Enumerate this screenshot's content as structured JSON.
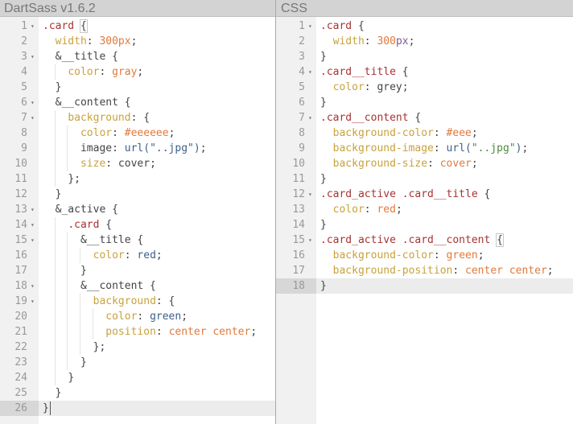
{
  "left_pane": {
    "title": "DartSass v1.6.2",
    "active_line": 26,
    "lines": [
      {
        "n": "1",
        "fold": true,
        "indent": 0,
        "tokens": [
          {
            "t": "sel",
            "v": ".card"
          },
          {
            "t": "plain",
            "v": " "
          },
          {
            "t": "plain",
            "v": "{",
            "match": true
          }
        ]
      },
      {
        "n": "2",
        "fold": false,
        "indent": 1,
        "tokens": [
          {
            "t": "prop",
            "v": "width"
          },
          {
            "t": "plain",
            "v": ": "
          },
          {
            "t": "num",
            "v": "300px"
          },
          {
            "t": "plain",
            "v": ";"
          }
        ]
      },
      {
        "n": "3",
        "fold": true,
        "indent": 1,
        "tokens": [
          {
            "t": "plain",
            "v": "&__title {"
          }
        ]
      },
      {
        "n": "4",
        "fold": false,
        "indent": 2,
        "tokens": [
          {
            "t": "prop",
            "v": "color"
          },
          {
            "t": "plain",
            "v": ": "
          },
          {
            "t": "val",
            "v": "gray"
          },
          {
            "t": "plain",
            "v": ";"
          }
        ]
      },
      {
        "n": "5",
        "fold": false,
        "indent": 1,
        "tokens": [
          {
            "t": "plain",
            "v": "}"
          }
        ]
      },
      {
        "n": "6",
        "fold": true,
        "indent": 1,
        "tokens": [
          {
            "t": "plain",
            "v": "&__content {"
          }
        ]
      },
      {
        "n": "7",
        "fold": true,
        "indent": 2,
        "tokens": [
          {
            "t": "prop",
            "v": "background"
          },
          {
            "t": "plain",
            "v": ": {"
          }
        ]
      },
      {
        "n": "8",
        "fold": false,
        "indent": 3,
        "tokens": [
          {
            "t": "prop",
            "v": "color"
          },
          {
            "t": "plain",
            "v": ": "
          },
          {
            "t": "hex",
            "v": "#eeeeee"
          },
          {
            "t": "plain",
            "v": ";"
          }
        ]
      },
      {
        "n": "9",
        "fold": false,
        "indent": 3,
        "tokens": [
          {
            "t": "plain",
            "v": "image: "
          },
          {
            "t": "url",
            "v": "url(\"..jpg\")"
          },
          {
            "t": "plain",
            "v": ";"
          }
        ]
      },
      {
        "n": "10",
        "fold": false,
        "indent": 3,
        "tokens": [
          {
            "t": "prop",
            "v": "size"
          },
          {
            "t": "plain",
            "v": ": cover;"
          }
        ]
      },
      {
        "n": "11",
        "fold": false,
        "indent": 2,
        "tokens": [
          {
            "t": "plain",
            "v": "};"
          }
        ]
      },
      {
        "n": "12",
        "fold": false,
        "indent": 1,
        "tokens": [
          {
            "t": "plain",
            "v": "}"
          }
        ]
      },
      {
        "n": "13",
        "fold": true,
        "indent": 1,
        "tokens": [
          {
            "t": "plain",
            "v": "&_active {"
          }
        ]
      },
      {
        "n": "14",
        "fold": true,
        "indent": 2,
        "tokens": [
          {
            "t": "sel",
            "v": ".card"
          },
          {
            "t": "plain",
            "v": " {"
          }
        ]
      },
      {
        "n": "15",
        "fold": true,
        "indent": 3,
        "tokens": [
          {
            "t": "plain",
            "v": "&__title {"
          }
        ]
      },
      {
        "n": "16",
        "fold": false,
        "indent": 4,
        "tokens": [
          {
            "t": "prop",
            "v": "color"
          },
          {
            "t": "plain",
            "v": ": "
          },
          {
            "t": "kw",
            "v": "red"
          },
          {
            "t": "plain",
            "v": ";"
          }
        ]
      },
      {
        "n": "17",
        "fold": false,
        "indent": 3,
        "tokens": [
          {
            "t": "plain",
            "v": "}"
          }
        ]
      },
      {
        "n": "18",
        "fold": true,
        "indent": 3,
        "tokens": [
          {
            "t": "plain",
            "v": "&__content {"
          }
        ]
      },
      {
        "n": "19",
        "fold": true,
        "indent": 4,
        "tokens": [
          {
            "t": "prop",
            "v": "background"
          },
          {
            "t": "plain",
            "v": ": {"
          }
        ]
      },
      {
        "n": "20",
        "fold": false,
        "indent": 5,
        "tokens": [
          {
            "t": "prop",
            "v": "color"
          },
          {
            "t": "plain",
            "v": ": "
          },
          {
            "t": "kw",
            "v": "green"
          },
          {
            "t": "plain",
            "v": ";"
          }
        ]
      },
      {
        "n": "21",
        "fold": false,
        "indent": 5,
        "tokens": [
          {
            "t": "prop",
            "v": "position"
          },
          {
            "t": "plain",
            "v": ": "
          },
          {
            "t": "val",
            "v": "center center"
          },
          {
            "t": "plain",
            "v": ";"
          }
        ]
      },
      {
        "n": "22",
        "fold": false,
        "indent": 4,
        "tokens": [
          {
            "t": "plain",
            "v": "};"
          }
        ]
      },
      {
        "n": "23",
        "fold": false,
        "indent": 3,
        "tokens": [
          {
            "t": "plain",
            "v": "}"
          }
        ]
      },
      {
        "n": "24",
        "fold": false,
        "indent": 2,
        "tokens": [
          {
            "t": "plain",
            "v": "}"
          }
        ]
      },
      {
        "n": "25",
        "fold": false,
        "indent": 1,
        "tokens": [
          {
            "t": "plain",
            "v": "}"
          }
        ]
      },
      {
        "n": "26",
        "fold": false,
        "indent": 0,
        "tokens": [
          {
            "t": "plain",
            "v": "}"
          }
        ],
        "cursor": true
      }
    ]
  },
  "right_pane": {
    "title": "CSS",
    "active_line": 18,
    "lines": [
      {
        "n": "1",
        "fold": true,
        "indent": 0,
        "tokens": [
          {
            "t": "sel",
            "v": ".card"
          },
          {
            "t": "plain",
            "v": " {"
          }
        ]
      },
      {
        "n": "2",
        "fold": false,
        "indent": 1,
        "tokens": [
          {
            "t": "prop",
            "v": "width"
          },
          {
            "t": "plain",
            "v": ": "
          },
          {
            "t": "num",
            "v": "300"
          },
          {
            "t": "unit",
            "v": "px"
          },
          {
            "t": "plain",
            "v": ";"
          }
        ]
      },
      {
        "n": "3",
        "fold": false,
        "indent": 0,
        "tokens": [
          {
            "t": "plain",
            "v": "}"
          }
        ]
      },
      {
        "n": "4",
        "fold": true,
        "indent": 0,
        "tokens": [
          {
            "t": "sel",
            "v": ".card__title"
          },
          {
            "t": "plain",
            "v": " {"
          }
        ]
      },
      {
        "n": "5",
        "fold": false,
        "indent": 1,
        "tokens": [
          {
            "t": "prop",
            "v": "color"
          },
          {
            "t": "plain",
            "v": ": grey;"
          }
        ]
      },
      {
        "n": "6",
        "fold": false,
        "indent": 0,
        "tokens": [
          {
            "t": "plain",
            "v": "}"
          }
        ]
      },
      {
        "n": "7",
        "fold": true,
        "indent": 0,
        "tokens": [
          {
            "t": "sel",
            "v": ".card__content"
          },
          {
            "t": "plain",
            "v": " {"
          }
        ]
      },
      {
        "n": "8",
        "fold": false,
        "indent": 1,
        "tokens": [
          {
            "t": "prop",
            "v": "background-color"
          },
          {
            "t": "plain",
            "v": ": "
          },
          {
            "t": "hex",
            "v": "#eee"
          },
          {
            "t": "plain",
            "v": ";"
          }
        ]
      },
      {
        "n": "9",
        "fold": false,
        "indent": 1,
        "tokens": [
          {
            "t": "prop",
            "v": "background-image"
          },
          {
            "t": "plain",
            "v": ": "
          },
          {
            "t": "url",
            "v": "url("
          },
          {
            "t": "str",
            "v": "\"..jpg\""
          },
          {
            "t": "url",
            "v": ")"
          },
          {
            "t": "plain",
            "v": ";"
          }
        ]
      },
      {
        "n": "10",
        "fold": false,
        "indent": 1,
        "tokens": [
          {
            "t": "prop",
            "v": "background-size"
          },
          {
            "t": "plain",
            "v": ": "
          },
          {
            "t": "val",
            "v": "cover"
          },
          {
            "t": "plain",
            "v": ";"
          }
        ]
      },
      {
        "n": "11",
        "fold": false,
        "indent": 0,
        "tokens": [
          {
            "t": "plain",
            "v": "}"
          }
        ]
      },
      {
        "n": "12",
        "fold": true,
        "indent": 0,
        "tokens": [
          {
            "t": "sel",
            "v": ".card_active .card__title"
          },
          {
            "t": "plain",
            "v": " {"
          }
        ]
      },
      {
        "n": "13",
        "fold": false,
        "indent": 1,
        "tokens": [
          {
            "t": "prop",
            "v": "color"
          },
          {
            "t": "plain",
            "v": ": "
          },
          {
            "t": "val",
            "v": "red"
          },
          {
            "t": "plain",
            "v": ";"
          }
        ]
      },
      {
        "n": "14",
        "fold": false,
        "indent": 0,
        "tokens": [
          {
            "t": "plain",
            "v": "}"
          }
        ]
      },
      {
        "n": "15",
        "fold": true,
        "indent": 0,
        "tokens": [
          {
            "t": "sel",
            "v": ".card_active .card__content"
          },
          {
            "t": "plain",
            "v": " "
          },
          {
            "t": "plain",
            "v": "{",
            "match": true
          }
        ]
      },
      {
        "n": "16",
        "fold": false,
        "indent": 1,
        "tokens": [
          {
            "t": "prop",
            "v": "background-color"
          },
          {
            "t": "plain",
            "v": ": "
          },
          {
            "t": "val",
            "v": "green"
          },
          {
            "t": "plain",
            "v": ";"
          }
        ]
      },
      {
        "n": "17",
        "fold": false,
        "indent": 1,
        "tokens": [
          {
            "t": "prop",
            "v": "background-position"
          },
          {
            "t": "plain",
            "v": ": "
          },
          {
            "t": "val",
            "v": "center center"
          },
          {
            "t": "plain",
            "v": ";"
          }
        ]
      },
      {
        "n": "18",
        "fold": false,
        "indent": 0,
        "tokens": [
          {
            "t": "plain",
            "v": "}"
          }
        ]
      }
    ]
  },
  "icons": {
    "fold": "▾"
  }
}
